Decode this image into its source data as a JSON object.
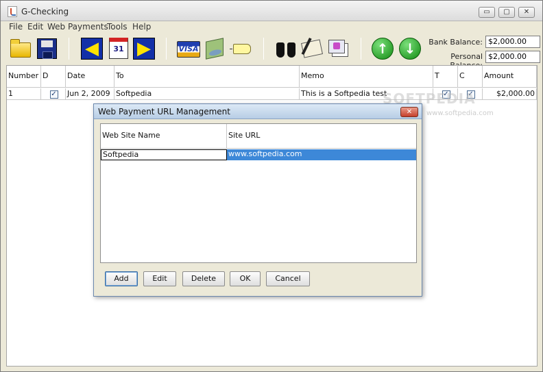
{
  "window": {
    "title": "G-Checking",
    "minimize": "▭",
    "maximize": "▢",
    "close": "✕"
  },
  "menu": [
    "File",
    "Edit",
    "Web Payments",
    "Tools",
    "Help"
  ],
  "toolbar": {
    "buttons": [
      "open-folder",
      "save",
      "previous",
      "calendar",
      "next",
      "visa-card",
      "money",
      "tag",
      "find",
      "sign",
      "checks",
      "up",
      "down"
    ],
    "calendar_day": "31",
    "visa_text": "VISA",
    "bank_balance_label": "Bank Balance:",
    "bank_balance_value": "$2,000.00",
    "personal_balance_label": "Personal Balance:",
    "personal_balance_value": "$2,000.00"
  },
  "register": {
    "columns": [
      "Number",
      "D",
      "Date",
      "To",
      "Memo",
      "T",
      "C",
      "Amount"
    ],
    "rows": [
      {
        "number": "1",
        "d": true,
        "date": "Jun 2, 2009",
        "to": "Softpedia",
        "memo": "This is a Softpedia test",
        "t": true,
        "c": true,
        "amount": "$2,000.00"
      }
    ],
    "checkmark": "✓",
    "watermark": "SOFTPEDIA",
    "watermark_sub": "www.softpedia.com"
  },
  "dialog": {
    "title": "Web Payment URL Management",
    "close": "✕",
    "columns": [
      "Web Site Name",
      "Site URL"
    ],
    "rows": [
      {
        "name": "Softpedia",
        "url": "www.softpedia.com"
      }
    ],
    "buttons": {
      "add": "Add",
      "edit": "Edit",
      "delete": "Delete",
      "ok": "OK",
      "cancel": "Cancel"
    }
  }
}
